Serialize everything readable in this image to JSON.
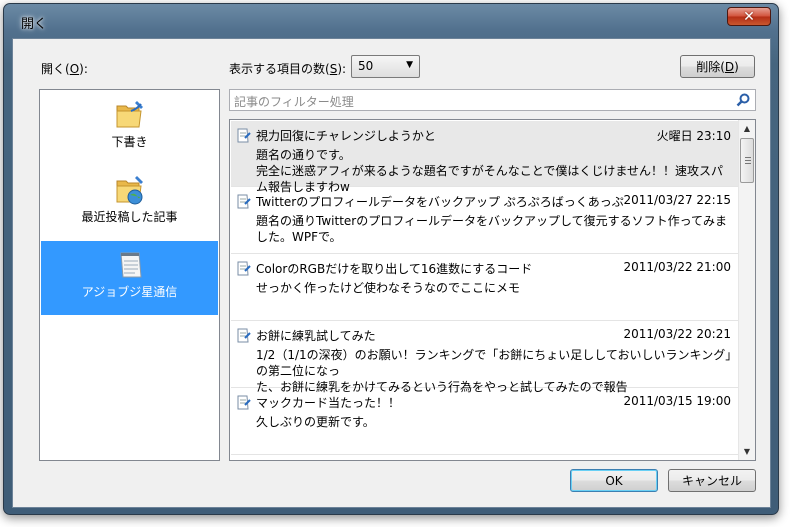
{
  "window": {
    "title": "開く",
    "close_glyph": "✕"
  },
  "toolbar": {
    "open_label": "開く(",
    "open_key": "O",
    "open_label_end": "):",
    "count_label": "表示する項目の数(",
    "count_key": "S",
    "count_label_end": "):",
    "count_value": "50",
    "delete_label": "削除(",
    "delete_key": "D",
    "delete_label_end": ")"
  },
  "sidebar": {
    "items": [
      {
        "label": "下書き",
        "icon": "drafts-folder-icon",
        "selected": false
      },
      {
        "label": "最近投稿した記事",
        "icon": "recent-posts-folder-icon",
        "selected": false
      },
      {
        "label": "アジョブジ星通信",
        "icon": "blog-notepad-icon",
        "selected": true
      }
    ]
  },
  "search": {
    "placeholder": "記事のフィルター処理",
    "icon": "search-icon"
  },
  "entries": [
    {
      "title": "視力回復にチャレンジしようかと",
      "date": "火曜日 23:10",
      "body": [
        "題名の通りです。",
        "完全に迷惑アフィが来るような題名ですがそんなことで僕はくじけません！！速攻スパム報告しますわw"
      ],
      "selected": true
    },
    {
      "title": "Twitterのプロフィールデータをバックアップ ぷろぷろばっくあっぷ",
      "date": "2011/03/27 22:15",
      "body": [
        "題名の通りTwitterのプロフィールデータをバックアップして復元するソフト作ってみました。WPFで。"
      ],
      "selected": false
    },
    {
      "title": "ColorのRGBだけを取り出して16進数にするコード",
      "date": "2011/03/22 21:00",
      "body": [
        "せっかく作ったけど使わなそうなのでここにメモ"
      ],
      "selected": false
    },
    {
      "title": "お餅に練乳試してみた",
      "date": "2011/03/22 20:21",
      "body": [
        "1/2（1/1の深夜）のお願い！ランキングで「お餅にちょい足ししておいしいランキング」の第二位になっ",
        "た、お餅に練乳をかけてみるという行為をやっと試してみたので報告"
      ],
      "selected": false
    },
    {
      "title": "マックカード当たった！！",
      "date": "2011/03/15 19:00",
      "body": [
        "久しぶりの更新です。"
      ],
      "selected": false
    }
  ],
  "footer": {
    "ok_label": "OK",
    "cancel_label": "キャンセル"
  }
}
